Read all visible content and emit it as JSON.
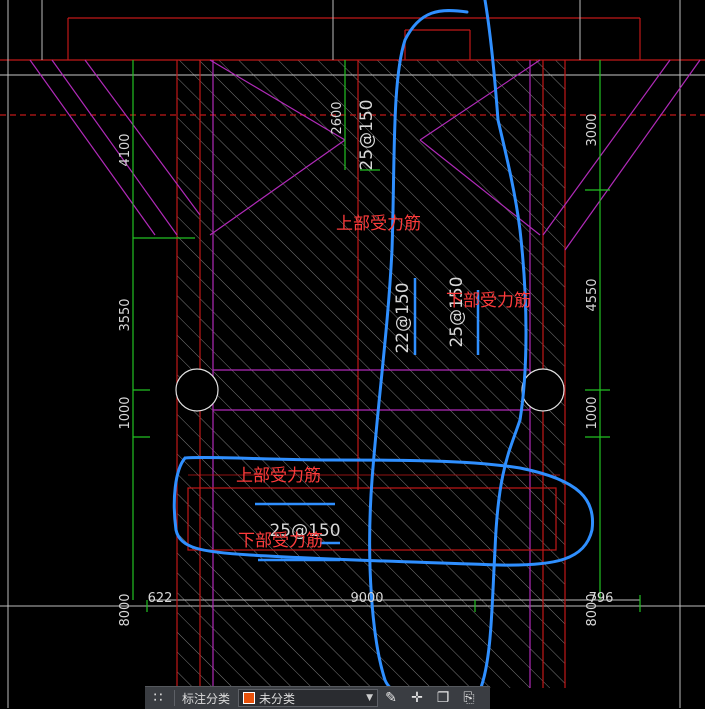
{
  "drawing": {
    "dimensions_left": [
      "4100",
      "3550",
      "1000",
      "8000"
    ],
    "dimensions_right": [
      "3000",
      "4550",
      "1000",
      "8000"
    ],
    "dimension_top_center": "2600",
    "dimension_bottom": {
      "left": "622",
      "center": "9000",
      "right": "796"
    },
    "rebar_labels": [
      "25@150",
      "22@150",
      "25@150",
      "25@150"
    ],
    "notes": {
      "upper_main": "上部受力筋",
      "lower_main": "下部受力筋",
      "upper_beam": "上部受力筋",
      "lower_beam": "下部受力筋"
    }
  },
  "colors": {
    "background": "#000000",
    "outline_red": "#c01818",
    "magenta": "#b02ab8",
    "green": "#22c022",
    "hatch": "#7a7a7a",
    "annotation_blue": "#2f8fff",
    "note_red": "#ff3b3b",
    "swatch": "#e8520c"
  },
  "toolbar": {
    "grid_icon": "grid-icon",
    "label": "标注分类",
    "select_value": "未分类",
    "icons": [
      "edit-icon",
      "move-icon",
      "copy-icon",
      "paste-icon"
    ]
  }
}
